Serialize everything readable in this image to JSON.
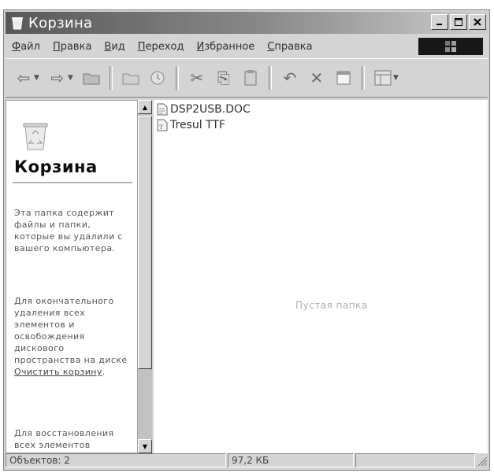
{
  "window": {
    "title": "Корзина"
  },
  "menu": [
    "Файл",
    "Правка",
    "Вид",
    "Переход",
    "Избранное",
    "Справка"
  ],
  "left_pane": {
    "title": "Корзина",
    "paragraph1": "Эта папка содержит файлы и папки, которые вы удалили с вашего компьютера.",
    "paragraph2_prefix": "Для окончательного удаления всех элементов и освобождения дискового пространства на диске",
    "paragraph2_link": "Очистить корзину",
    "paragraph3": "Для восстановления всех элементов"
  },
  "files": [
    {
      "name": "DSP2USB.DOC",
      "icon": "word-document-icon"
    },
    {
      "name": "Tresul TTF",
      "icon": "font-file-icon"
    }
  ],
  "center_hint": "Пустая папка",
  "status": {
    "objects": "Объектов: 2",
    "size": "97,2 КБ"
  }
}
